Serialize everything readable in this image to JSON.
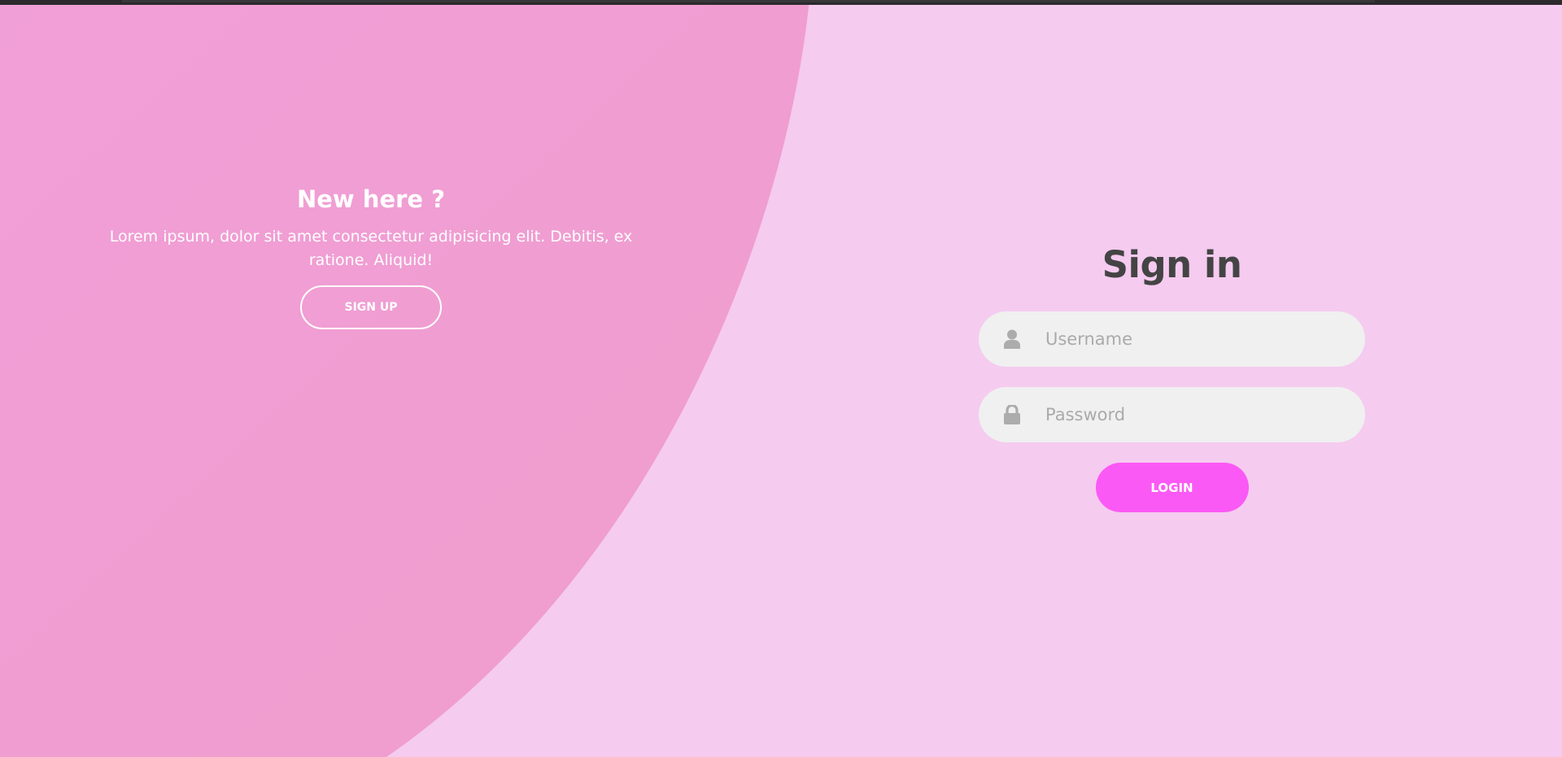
{
  "colors": {
    "background": "#f5cbf0",
    "panel": "#f09ed6",
    "accent": "#fb59f5",
    "input_bg": "#f0f0f0",
    "title": "#444444"
  },
  "left_panel": {
    "title": "New here ?",
    "text": "Lorem ipsum, dolor sit amet consectetur adipisicing elit. Debitis, ex ratione. Aliquid!",
    "signup_label": "SIGN UP"
  },
  "form": {
    "title": "Sign in",
    "username": {
      "placeholder": "Username",
      "value": "",
      "icon": "user-icon"
    },
    "password": {
      "placeholder": "Password",
      "value": "",
      "icon": "lock-icon"
    },
    "login_label": "LOGIN"
  }
}
